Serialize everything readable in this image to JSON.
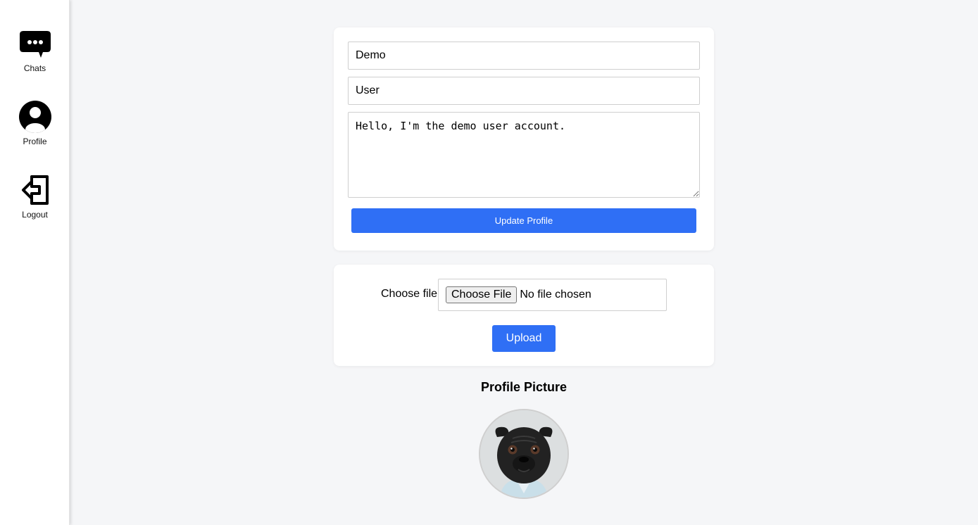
{
  "sidebar": {
    "items": [
      {
        "label": "Chats",
        "icon": "chat-bubble-icon"
      },
      {
        "label": "Profile",
        "icon": "user-circle-icon"
      },
      {
        "label": "Logout",
        "icon": "logout-icon"
      }
    ]
  },
  "profile_form": {
    "first_name": "Demo",
    "last_name": "User",
    "bio": "Hello, I'm the demo user account.",
    "update_label": "Update Profile"
  },
  "upload_form": {
    "choose_label": "Choose file",
    "choose_button": "Choose File",
    "no_file": "No file chosen",
    "upload_label": "Upload"
  },
  "profile_picture": {
    "title": "Profile Picture",
    "image": "pug-photo"
  },
  "colors": {
    "accent": "#2f6ff5",
    "background": "#f5f6f8",
    "card": "#ffffff"
  }
}
